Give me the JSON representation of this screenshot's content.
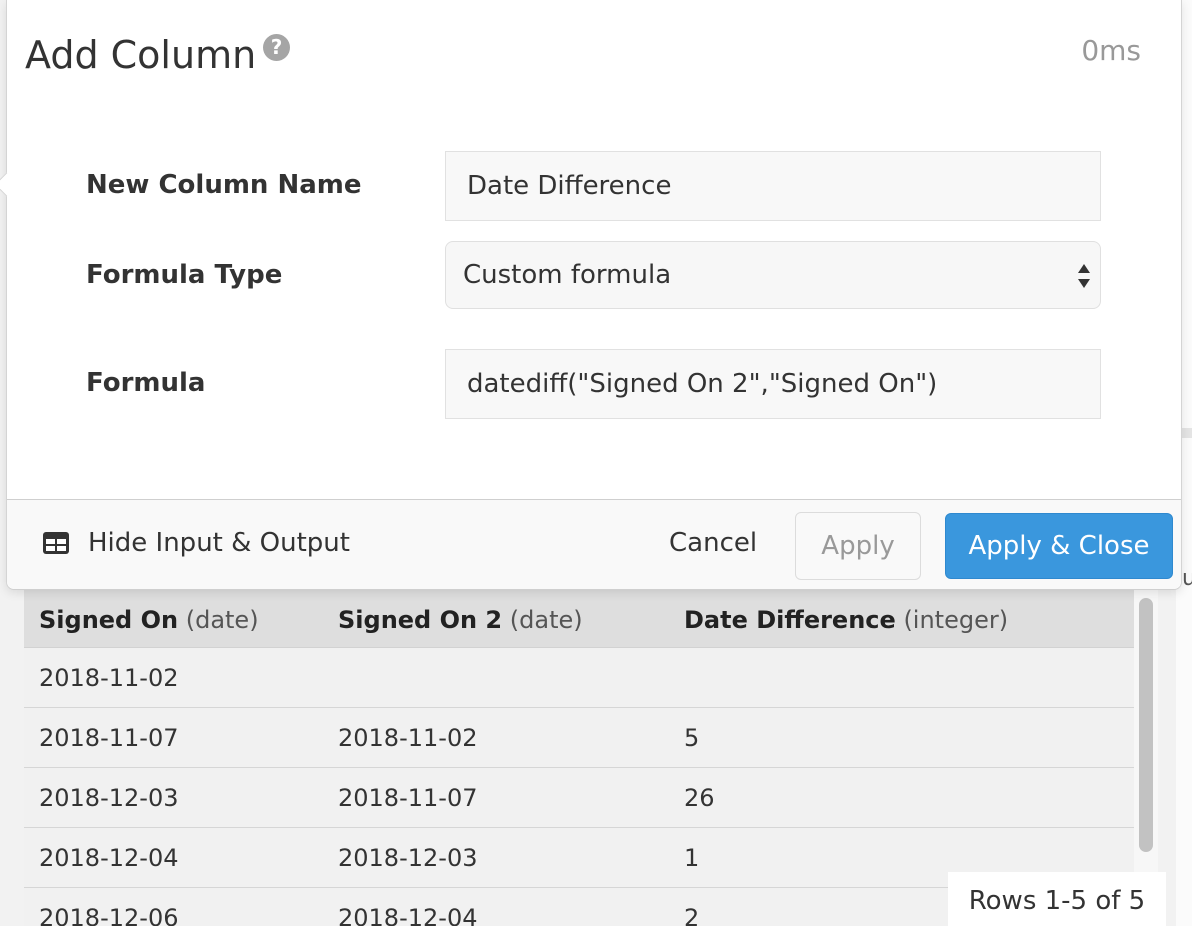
{
  "dialog": {
    "title": "Add Column",
    "help_icon": "question-circle-icon",
    "timing": "0ms"
  },
  "form": {
    "column_name_label": "New Column Name",
    "column_name_value": "Date Difference",
    "formula_type_label": "Formula Type",
    "formula_type_value": "Custom formula",
    "formula_label": "Formula",
    "formula_value": "datediff(\"Signed On 2\",\"Signed On\")"
  },
  "footer": {
    "toggle_icon": "table-icon",
    "toggle_label": "Hide Input & Output",
    "cancel_label": "Cancel",
    "apply_label": "Apply",
    "apply_close_label": "Apply & Close"
  },
  "colors": {
    "primary_button": "#3a97dd",
    "help_icon": "#a5a5a5"
  },
  "output": {
    "columns": [
      {
        "name": "Signed On",
        "type": "(date)"
      },
      {
        "name": "Signed On 2",
        "type": "(date)"
      },
      {
        "name": "Date Difference",
        "type": "(integer)"
      }
    ],
    "rows": [
      [
        "2018-11-02",
        "",
        ""
      ],
      [
        "2018-11-07",
        "2018-11-02",
        "5"
      ],
      [
        "2018-12-03",
        "2018-11-07",
        "26"
      ],
      [
        "2018-12-04",
        "2018-12-03",
        "1"
      ],
      [
        "2018-12-06",
        "2018-12-04",
        "2"
      ]
    ],
    "rows_count": "Rows 1-5 of 5"
  }
}
